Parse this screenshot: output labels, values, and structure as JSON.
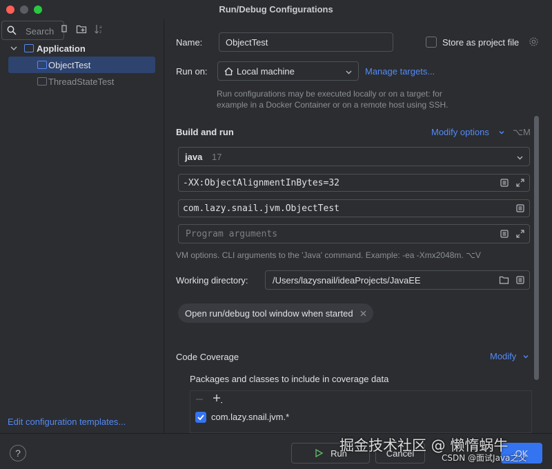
{
  "window": {
    "title": "Run/Debug Configurations"
  },
  "sidebar": {
    "search_placeholder": "Search",
    "tree": [
      {
        "label": "Application",
        "type": "group"
      },
      {
        "label": "ObjectTest",
        "type": "config",
        "selected": true
      },
      {
        "label": "ThreadStateTest",
        "type": "config",
        "selected": false
      }
    ],
    "edit_templates": "Edit configuration templates..."
  },
  "form": {
    "name_label": "Name:",
    "name_value": "ObjectTest",
    "store_label": "Store as project file",
    "runon_label": "Run on:",
    "runon_value": "Local machine",
    "manage_targets": "Manage targets...",
    "runon_hint_1": "Run configurations may be executed locally or on a target: for",
    "runon_hint_2": "example in a Docker Container or on a remote host using SSH.",
    "build_run": "Build and run",
    "modify_options": "Modify options",
    "modify_shortcut": "⌥M",
    "jdk_name": "java",
    "jdk_version": "17",
    "vm_options": "-XX:ObjectAlignmentInBytes=32",
    "main_class": "com.lazy.snail.jvm.ObjectTest",
    "program_args_placeholder": "Program arguments",
    "vm_hint": "VM options. CLI arguments to the 'Java' command. Example: -ea -Xmx2048m. ⌥V",
    "workdir_label": "Working directory:",
    "workdir_value": "/Users/lazysnail/ideaProjects/JavaEE",
    "chip_label": "Open run/debug tool window when started",
    "coverage_title": "Code Coverage",
    "coverage_modify": "Modify",
    "coverage_packages": "Packages and classes to include in coverage data",
    "coverage_entry": "com.lazy.snail.jvm.*"
  },
  "buttons": {
    "run": "Run",
    "cancel": "Cancel",
    "ok": "OK",
    "help": "?"
  },
  "watermark": {
    "main": "掘金技术社区 @ 懒惰蜗牛",
    "sub": "CSDN @面试Java之父"
  },
  "colors": {
    "accent": "#3574f0",
    "link": "#548af7",
    "selection": "#2e436e",
    "background": "#2b2d30"
  }
}
